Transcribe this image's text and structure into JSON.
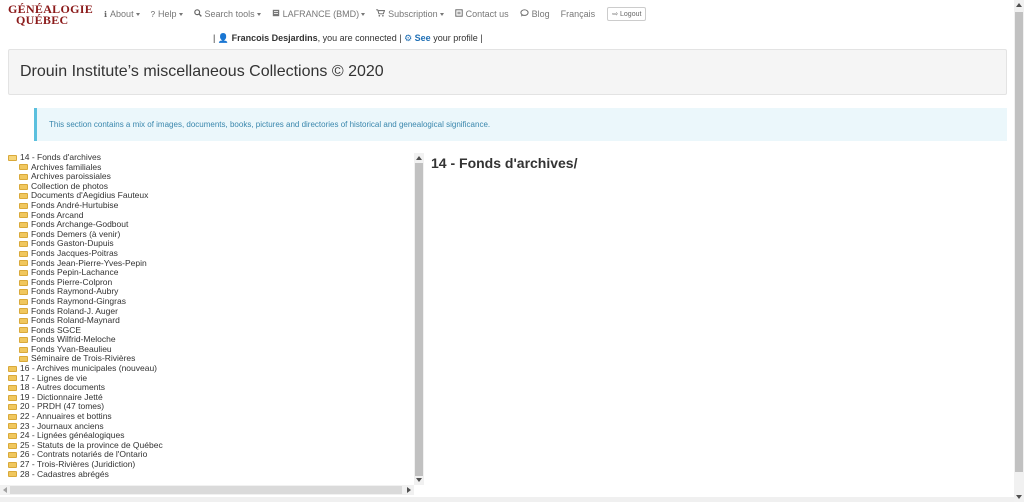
{
  "logo": {
    "line1": "GÉNÉALOGIE",
    "line2": "QUÉBEC"
  },
  "nav": {
    "about": "About",
    "help": "Help",
    "search_tools": "Search tools",
    "lafrance": "LAFRANCE (BMD)",
    "subscription": "Subscription",
    "contact": "Contact us",
    "blog": "Blog",
    "language": "Français",
    "logout": "Logout"
  },
  "user": {
    "name": "Francois Desjardins",
    "connected_text": ", you are connected",
    "see": "See",
    "profile_text": "your profile"
  },
  "page": {
    "title": "Drouin Institute’s miscellaneous Collections © 2020",
    "info": "This section contains a mix of images, documents, books, pictures and directories of historical and genealogical significance."
  },
  "tree": {
    "root": "14 - Fonds d'archives",
    "children": [
      "Archives familiales",
      "Archives paroissiales",
      "Collection de photos",
      "Documents d'Aegidius Fauteux",
      "Fonds André-Hurtubise",
      "Fonds Arcand",
      "Fonds Archange-Godbout",
      "Fonds Demers (à venir)",
      "Fonds Gaston-Dupuis",
      "Fonds Jacques-Poitras",
      "Fonds Jean-Pierre-Yves-Pepin",
      "Fonds Pepin-Lachance",
      "Fonds Pierre-Colpron",
      "Fonds Raymond-Aubry",
      "Fonds Raymond-Gingras",
      "Fonds Roland-J. Auger",
      "Fonds Roland-Maynard",
      "Fonds SGCE",
      "Fonds Wilfrid-Meloche",
      "Fonds Yvan-Beaulieu",
      "Séminaire de Trois-Rivières"
    ],
    "others": [
      "16 - Archives municipales (nouveau)",
      "17 - Lignes de vie",
      "18 - Autres documents",
      "19 - Dictionnaire Jetté",
      "20 - PRDH (47 tomes)",
      "22 - Annuaires et bottins",
      "23 - Journaux anciens",
      "24 - Lignées généalogiques",
      "25 - Statuts de la province de Québec",
      "26 - Contrats notariés de l'Ontario",
      "27 - Trois-Rivières (Juridiction)",
      "28 - Cadastres abrégés"
    ]
  },
  "content": {
    "title": "14 - Fonds d'archives/"
  },
  "colors": {
    "logo": "#8b1a1a",
    "link": "#1f6fb5",
    "info_bg": "#ebf7fb",
    "info_border": "#5bc0de",
    "folder": "#f0c75e"
  }
}
